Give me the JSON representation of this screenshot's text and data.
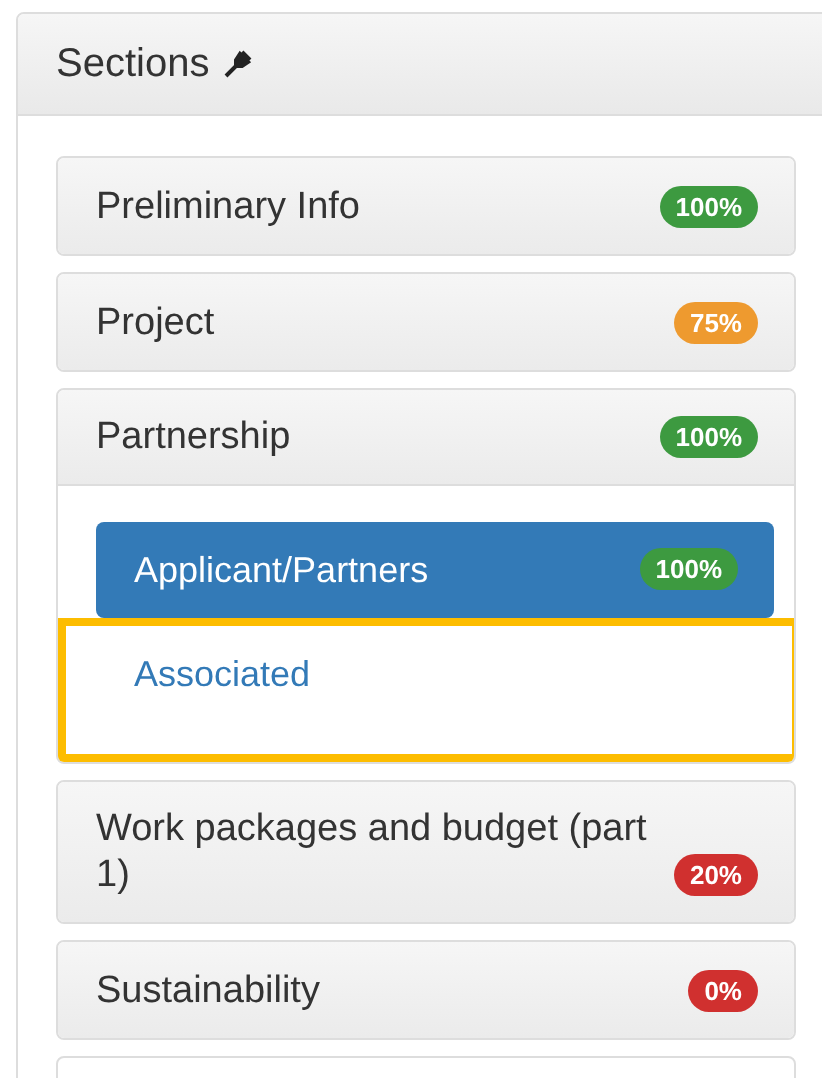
{
  "panel": {
    "title": "Sections"
  },
  "sections": [
    {
      "label": "Preliminary Info",
      "badge": "100%",
      "color": "#3d9a40",
      "expanded": false
    },
    {
      "label": "Project",
      "badge": "75%",
      "color": "#ee9a2f",
      "expanded": false
    },
    {
      "label": "Partnership",
      "badge": "100%",
      "color": "#3d9a40",
      "expanded": true,
      "children": [
        {
          "label": "Applicant/Partners",
          "badge": "100%",
          "color": "#3d9a40",
          "selected": true,
          "highlighted": false
        },
        {
          "label": "Associated",
          "selected": false,
          "highlighted": true
        }
      ]
    },
    {
      "label": "Work packages and budget (part 1)",
      "badge": "20%",
      "color": "#d0302f",
      "expanded": false
    },
    {
      "label": "Sustainability",
      "badge": "0%",
      "color": "#d0302f",
      "expanded": false
    }
  ]
}
